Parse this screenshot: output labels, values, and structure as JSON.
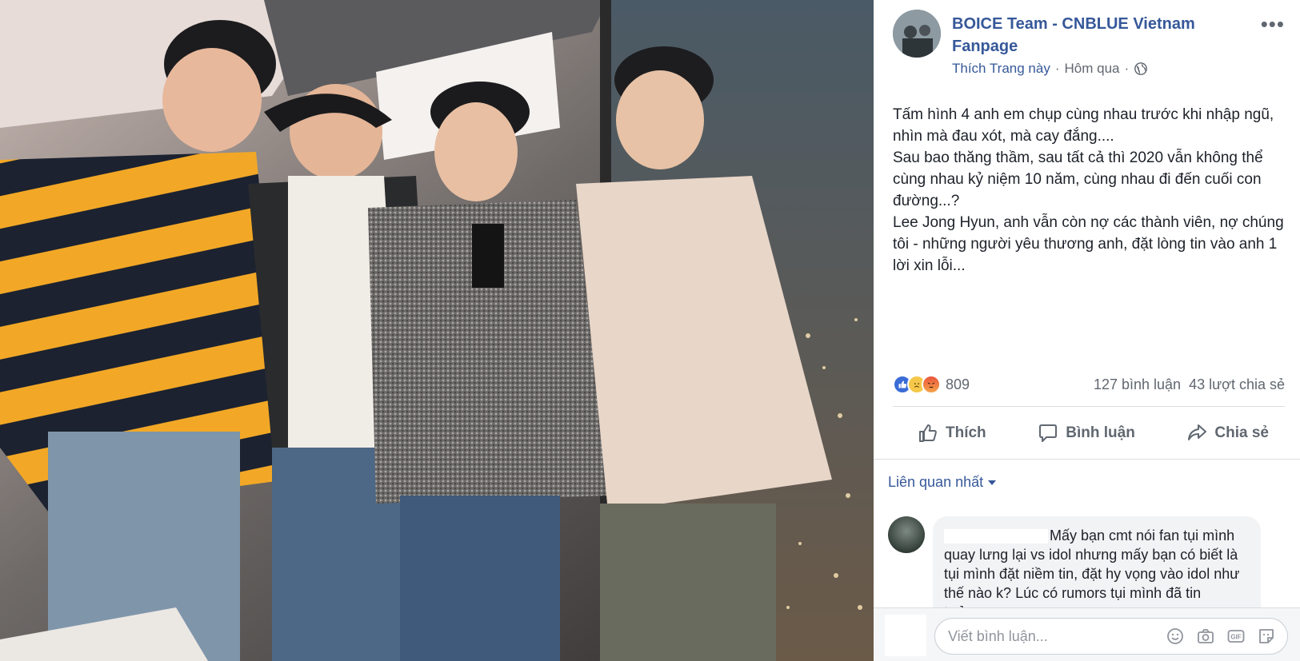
{
  "post": {
    "page_name": "BOICE Team - CNBLUE Vietnam Fanpage",
    "like_page": "Thích Trang này",
    "separator": "·",
    "time": "Hôm qua",
    "more_icon": "more-horizontal-icon",
    "privacy_icon": "globe-icon",
    "text": [
      "Tấm hình 4 anh em chụp cùng nhau trước khi nhập ngũ, nhìn mà đau xót, mà cay đắng....",
      "Sau bao thăng thầm, sau tất cả thì 2020 vẫn không thể cùng nhau kỷ niệm 10 năm, cùng nhau đi đến cuối con đường...?",
      "Lee Jong Hyun, anh vẫn còn nợ các thành viên, nợ chúng tôi - những người yêu thương anh, đặt lòng tin vào anh 1 lời xin lỗi..."
    ]
  },
  "stats": {
    "reactions": [
      "like",
      "sad",
      "angry"
    ],
    "reaction_count": "809",
    "comments": "127 bình luận",
    "shares": "43 lượt chia sẻ"
  },
  "actions": {
    "like": "Thích",
    "comment": "Bình luận",
    "share": "Chia sẻ"
  },
  "comments": {
    "sort_label": "Liên quan nhất",
    "first_comment": "Mấy bạn cmt nói fan tụi mình quay lưng lại vs idol nhưng mấy bạn có biết là tụi mình đặt niềm tin, đặt hy vọng vào idol như thế nào k? Lúc có rumors tụi mình đã tin tưởng..."
  },
  "composer": {
    "placeholder": "Viết bình luận...",
    "tools": [
      "emoji-icon",
      "camera-icon",
      "gif-icon",
      "sticker-icon"
    ]
  },
  "colors": {
    "link": "#365899",
    "muted": "#616770",
    "like_blue": "#3a6cd6"
  }
}
